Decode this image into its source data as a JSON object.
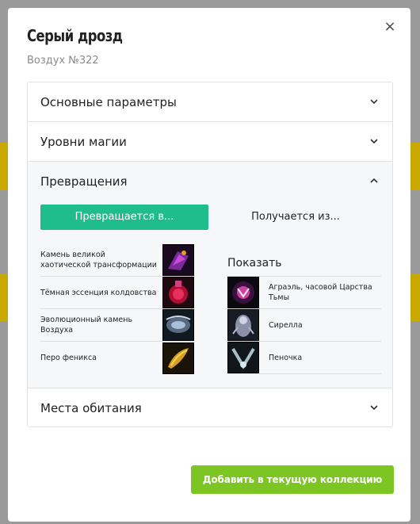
{
  "modal": {
    "title": "Серый дрозд",
    "subtitle": "Воздух №322",
    "close_label": "×"
  },
  "accordion": {
    "sections": [
      {
        "label": "Основные параметры",
        "expanded": false
      },
      {
        "label": "Уровни магии",
        "expanded": false
      },
      {
        "label": "Превращения",
        "expanded": true
      },
      {
        "label": "Места обитания",
        "expanded": false
      }
    ]
  },
  "transformations": {
    "tabs": [
      {
        "label": "Превращается в...",
        "active": true
      },
      {
        "label": "Получается из...",
        "active": false
      }
    ],
    "left_items": [
      {
        "label": "Камень великой хаотической трансформации",
        "icon": "chaos-stone-icon"
      },
      {
        "label": "Тёмная эссенция колдовства",
        "icon": "dark-essence-icon"
      },
      {
        "label": "Эволюционный камень Воздуха",
        "icon": "air-evolution-stone-icon"
      },
      {
        "label": "Перо феникса",
        "icon": "phoenix-feather-icon"
      }
    ],
    "show_label": "Показать",
    "right_items": [
      {
        "label": "Аграэль, часовой Царства Тьмы",
        "icon": "agrael-icon"
      },
      {
        "label": "Сирелла",
        "icon": "sirella-icon"
      },
      {
        "label": "Пеночка",
        "icon": "penochka-icon"
      }
    ]
  },
  "footer": {
    "add_button_label": "Добавить в текущую коллекцию"
  },
  "colors": {
    "tab_active": "#1ebd8b",
    "add_button": "#7cc523"
  }
}
